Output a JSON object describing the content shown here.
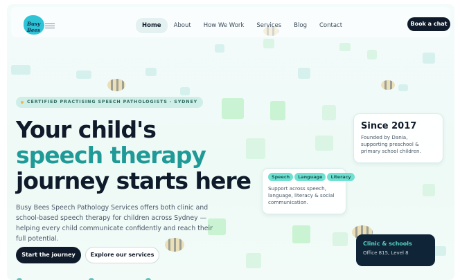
{
  "brand": {
    "logo_text": "Busy Bees"
  },
  "nav": {
    "items": [
      {
        "label": "Home",
        "active": true
      },
      {
        "label": "About",
        "active": false
      },
      {
        "label": "How We Work",
        "active": false
      },
      {
        "label": "Services",
        "active": false
      },
      {
        "label": "Blog",
        "active": false
      },
      {
        "label": "Contact",
        "active": false
      }
    ],
    "cta_label": "Book a chat"
  },
  "hero": {
    "badge": "CERTIFIED PRACTISING SPEECH PATHOLOGISTS · SYDNEY",
    "headline_line1": "Your child's",
    "headline_line2": "speech therapy",
    "headline_line3": "journey starts here",
    "lede": "Busy Bees Speech Pathology Services offers both clinic and school-based speech therapy for children across Sydney — helping every child communicate confidently and reach their full potential.",
    "primary_button": "Start the journey",
    "secondary_button": "Explore our services"
  },
  "cards": {
    "since": {
      "title": "Since 2017",
      "description": "Founded by Dania, supporting preschool & primary school children."
    },
    "tags": {
      "chips": [
        "Speech",
        "Language",
        "Literacy"
      ],
      "description": "Support across speech, language, literacy & social communication."
    },
    "clinic": {
      "title": "Clinic & schools",
      "description": "Office 815, Level 8"
    }
  },
  "colors": {
    "dark": "#0f1b2a",
    "teal_accent": "#1f9a97",
    "chip": "#6fe0d2",
    "badge_bg": "#cfeee8",
    "clinic_card": "#0f2436"
  }
}
